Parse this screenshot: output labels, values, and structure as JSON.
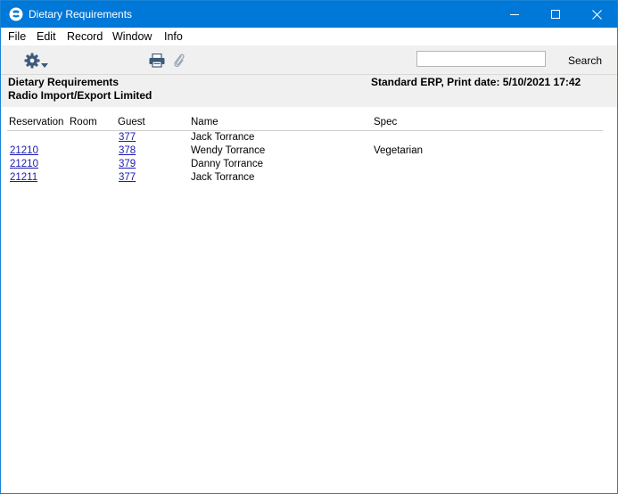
{
  "window": {
    "title": "Dietary Requirements",
    "accent_color": "#0078d7"
  },
  "menu": {
    "items": [
      "File",
      "Edit",
      "Record",
      "Window",
      "Info"
    ]
  },
  "toolbar": {
    "search_value": "",
    "search_label": "Search",
    "icons": [
      "gear-icon",
      "printer-icon",
      "paperclip-icon"
    ]
  },
  "report": {
    "title": "Dietary Requirements",
    "company": "Radio Import/Export Limited",
    "print_info": "Standard ERP, Print date: 5/10/2021 17:42",
    "columns": [
      "Reservation",
      "Room",
      "Guest",
      "Name",
      "Spec"
    ],
    "rows": [
      {
        "reservation": "",
        "room": "",
        "guest": "377",
        "name": "Jack Torrance",
        "spec": ""
      },
      {
        "reservation": "21210",
        "room": "",
        "guest": "378",
        "name": "Wendy Torrance",
        "spec": "Vegetarian"
      },
      {
        "reservation": "21210",
        "room": "",
        "guest": "379",
        "name": "Danny Torrance",
        "spec": ""
      },
      {
        "reservation": "21211",
        "room": "",
        "guest": "377",
        "name": "Jack Torrance",
        "spec": ""
      }
    ],
    "link_color": "#1a1ab0"
  }
}
